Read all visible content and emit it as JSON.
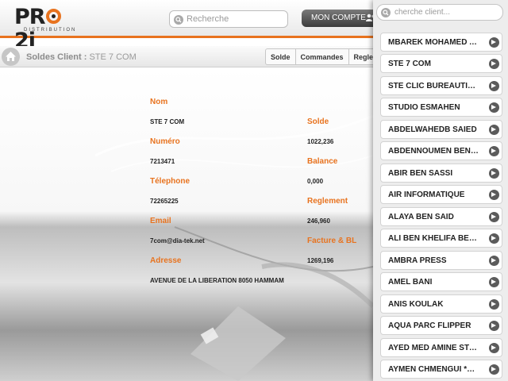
{
  "header": {
    "logo": {
      "text": "PRO 2i",
      "sub": "DISTRIBUTION"
    },
    "search_placeholder": "Recherche",
    "account_label": "MON COMPTE"
  },
  "subbar": {
    "title": "Soldes Client :",
    "client": "STE 7 COM",
    "tabs": [
      "Solde",
      "Commandes",
      "Reglem"
    ]
  },
  "info": {
    "left": [
      {
        "label": "Nom",
        "value": "STE 7 COM"
      },
      {
        "label": "Numéro",
        "value": "7213471"
      },
      {
        "label": "Télephone",
        "value": "72265225"
      },
      {
        "label": "Email",
        "value": "7com@dia-tek.net"
      },
      {
        "label": "Adresse",
        "value": "AVENUE DE LA LIBERATION 8050 HAMMAM"
      }
    ],
    "right": [
      {
        "label": "Solde",
        "value": "1022,236"
      },
      {
        "label": "Balance",
        "value": "0,000"
      },
      {
        "label": "Reglement",
        "value": "246,960"
      },
      {
        "label": "Facture & BL",
        "value": "1269,196"
      }
    ]
  },
  "panel": {
    "search_placeholder": "cherche client...",
    "clients": [
      "MBAREK MOHAMED AIDA",
      "STE 7 COM",
      "STE CLIC BUREAUTIQUE",
      "STUDIO ESMAHEN",
      "ABDELWAHEDB SAIED",
      "ABDENNOUMEN BEN ALI",
      "ABIR BEN SASSI",
      "AIR INFORMATIQUE",
      "ALAYA BEN SAID",
      "ALI BEN KHELIFA BEN ALI",
      "AMBRA PRESS",
      "AMEL BANI",
      "ANIS KOULAK",
      "AQUA PARC FLIPPER",
      "AYED MED AMINE STORE",
      "AYMEN CHMENGUI *ARIANA*"
    ]
  },
  "colors": {
    "accent": "#e8731f",
    "dark": "#3c3c3c"
  }
}
